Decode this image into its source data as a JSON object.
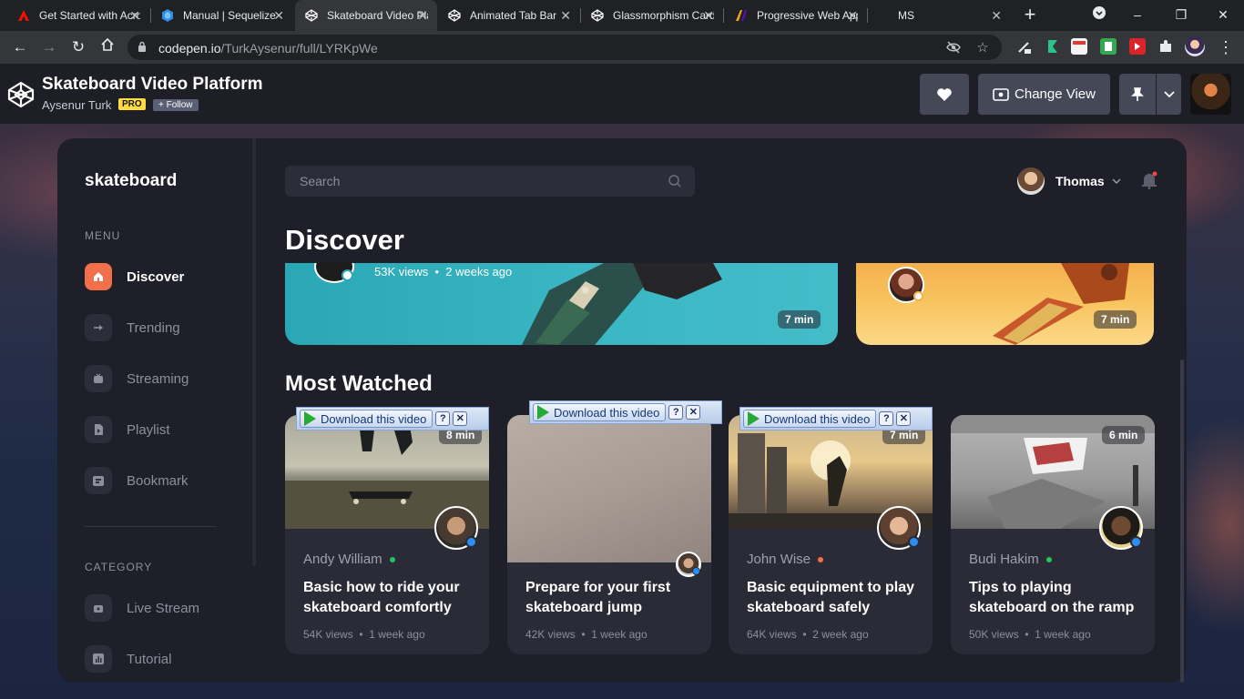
{
  "browser": {
    "tabs": [
      {
        "title": "Get Started with Acrobat",
        "icon": "adobe-icon",
        "active": false
      },
      {
        "title": "Manual | Sequelize",
        "icon": "sequelize-icon",
        "active": false
      },
      {
        "title": "Skateboard Video Platform",
        "icon": "codepen-icon",
        "active": true
      },
      {
        "title": "Animated Tab Bar",
        "icon": "codepen-icon",
        "active": false
      },
      {
        "title": "Glassmorphism Card",
        "icon": "codepen-icon",
        "active": false
      },
      {
        "title": "Progressive Web Apps",
        "icon": "pwa-icon",
        "active": false
      },
      {
        "title": "MS",
        "icon": "",
        "active": false
      }
    ],
    "url_host": "codepen.io",
    "url_path": "/TurkAysenur/full/LYRKpWe"
  },
  "codepen": {
    "title": "Skateboard Video Platform",
    "author": "Aysenur Turk",
    "pro_badge": "PRO",
    "follow_label": "+ Follow",
    "change_view_label": "Change View"
  },
  "app": {
    "brand": "skateboard",
    "menu_label": "MENU",
    "menu": [
      {
        "label": "Discover",
        "icon": "home-icon",
        "active": true
      },
      {
        "label": "Trending",
        "icon": "trending-icon",
        "active": false
      },
      {
        "label": "Streaming",
        "icon": "streaming-icon",
        "active": false
      },
      {
        "label": "Playlist",
        "icon": "playlist-icon",
        "active": false
      },
      {
        "label": "Bookmark",
        "icon": "bookmark-icon",
        "active": false
      }
    ],
    "category_label": "CATEGORY",
    "categories": [
      {
        "label": "Live Stream",
        "icon": "live-stream-icon"
      },
      {
        "label": "Tutorial",
        "icon": "tutorial-icon"
      }
    ],
    "search_placeholder": "Search",
    "user_name": "Thomas",
    "discover_title": "Discover",
    "featured": [
      {
        "views": "53K views",
        "age": "2 weeks ago",
        "duration": "7 min"
      },
      {
        "duration": "7 min"
      }
    ],
    "most_watched_title": "Most Watched",
    "download_label": "Download this video",
    "videos": [
      {
        "author": "Andy William",
        "status_color": "#22c55e",
        "title": "Basic how to ride your skateboard comfortly",
        "views": "54K views",
        "age": "1 week ago",
        "duration": "8 min"
      },
      {
        "author": "",
        "status_color": "",
        "title": "Prepare for your first skateboard jump",
        "views": "42K views",
        "age": "1 week ago",
        "duration": ""
      },
      {
        "author": "John Wise",
        "status_color": "#f26f4c",
        "title": "Basic equipment to play skateboard safely",
        "views": "64K views",
        "age": "2 week ago",
        "duration": "7 min"
      },
      {
        "author": "Budi Hakim",
        "status_color": "#22c55e",
        "title": "Tips to playing skateboard on the ramp",
        "views": "50K views",
        "age": "1 week ago",
        "duration": "6 min"
      }
    ]
  },
  "colors": {
    "accent": "#f26f4c",
    "panel": "#1f1f2a",
    "card": "#2a2b36",
    "verify": "#2b8ef5"
  }
}
